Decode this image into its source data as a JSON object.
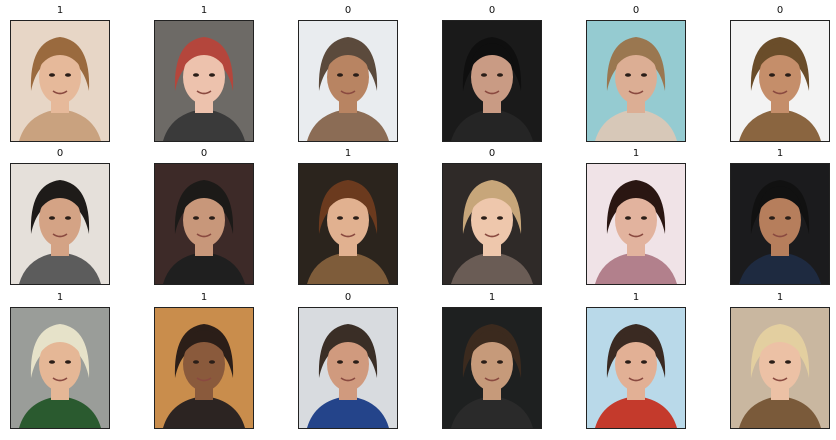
{
  "grid": {
    "cells": [
      {
        "label": "1",
        "palette": {
          "bg": "#e7d6c6",
          "hair": "#9a6a3e",
          "skin": "#e6b99a",
          "shirt": "#c9a27f"
        }
      },
      {
        "label": "1",
        "palette": {
          "bg": "#6d6a66",
          "hair": "#b4463c",
          "skin": "#edc2ad",
          "shirt": "#3a3a3a"
        }
      },
      {
        "label": "0",
        "palette": {
          "bg": "#e9ecef",
          "hair": "#5b4a3c",
          "skin": "#b88462",
          "shirt": "#8b6c55"
        }
      },
      {
        "label": "0",
        "palette": {
          "bg": "#1a1a1a",
          "hair": "#0f0f0f",
          "skin": "#c99b84",
          "shirt": "#252525"
        }
      },
      {
        "label": "0",
        "palette": {
          "bg": "#95cbd1",
          "hair": "#9a7750",
          "skin": "#dcae94",
          "shirt": "#d7c8b8"
        }
      },
      {
        "label": "0",
        "palette": {
          "bg": "#f3f3f3",
          "hair": "#6a4d2a",
          "skin": "#c58e6a",
          "shirt": "#8a6540"
        }
      },
      {
        "label": "0",
        "palette": {
          "bg": "#e5e0da",
          "hair": "#1e1b19",
          "skin": "#d4a385",
          "shirt": "#5c5c5c"
        }
      },
      {
        "label": "0",
        "palette": {
          "bg": "#3d2a28",
          "hair": "#1c1a18",
          "skin": "#c8977a",
          "shirt": "#1f1f1f"
        }
      },
      {
        "label": "1",
        "palette": {
          "bg": "#2b241d",
          "hair": "#6b3a1e",
          "skin": "#e1b190",
          "shirt": "#7e5c3a"
        }
      },
      {
        "label": "0",
        "palette": {
          "bg": "#2f2a28",
          "hair": "#c7a67a",
          "skin": "#eec7ac",
          "shirt": "#6a5c55"
        }
      },
      {
        "label": "1",
        "palette": {
          "bg": "#f0e3e7",
          "hair": "#2a1612",
          "skin": "#e2b39e",
          "shirt": "#b2808c"
        }
      },
      {
        "label": "1",
        "palette": {
          "bg": "#1b1b1d",
          "hair": "#111111",
          "skin": "#b67e5c",
          "shirt": "#1e2a40"
        }
      },
      {
        "label": "1",
        "palette": {
          "bg": "#9a9d99",
          "hair": "#e6e2c9",
          "skin": "#e5b796",
          "shirt": "#2a5a2f"
        }
      },
      {
        "label": "1",
        "palette": {
          "bg": "#c98d4c",
          "hair": "#2b1e18",
          "skin": "#8a5a3c",
          "shirt": "#2c2422"
        }
      },
      {
        "label": "0",
        "palette": {
          "bg": "#d8dbdf",
          "hair": "#3a2e26",
          "skin": "#d09a7e",
          "shirt": "#24448a"
        }
      },
      {
        "label": "1",
        "palette": {
          "bg": "#1e2020",
          "hair": "#3b2a1e",
          "skin": "#c69a7a",
          "shirt": "#2a2a2a"
        }
      },
      {
        "label": "1",
        "palette": {
          "bg": "#b9d9e9",
          "hair": "#3a2a22",
          "skin": "#e2b095",
          "shirt": "#c43a2c"
        }
      },
      {
        "label": "1",
        "palette": {
          "bg": "#c9b7a0",
          "hair": "#e3cfa0",
          "skin": "#ecc1a5",
          "shirt": "#7a5a3a"
        }
      }
    ]
  }
}
